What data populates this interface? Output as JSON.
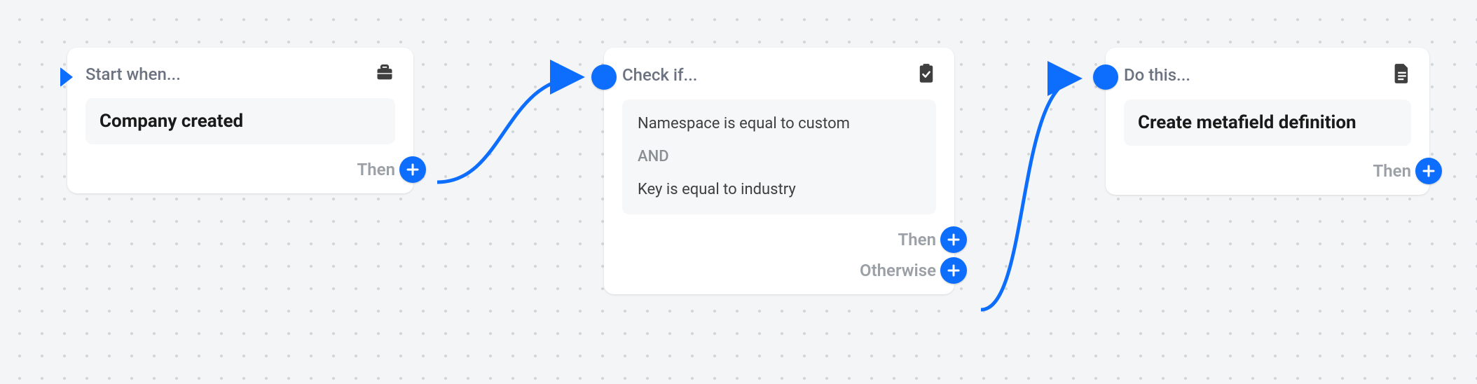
{
  "nodes": {
    "trigger": {
      "header": "Start when...",
      "title": "Company created",
      "then": "Then"
    },
    "condition": {
      "header": "Check if...",
      "line1": "Namespace is equal to custom",
      "op": "AND",
      "line2": "Key is equal to industry",
      "then": "Then",
      "otherwise": "Otherwise"
    },
    "action": {
      "header": "Do this...",
      "title": "Create metafield definition",
      "then": "Then"
    }
  }
}
